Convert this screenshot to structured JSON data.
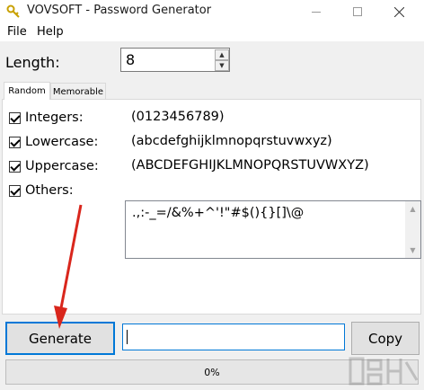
{
  "window": {
    "title": "VOVSOFT - Password Generator",
    "app_icon": "key-icon",
    "controls": [
      "minimize-icon",
      "maximize-icon",
      "close-icon"
    ]
  },
  "menu": [
    "File",
    "Help"
  ],
  "length": {
    "label": "Length:",
    "value": "8"
  },
  "tabs": [
    "Random",
    "Memorable"
  ],
  "active_tab": "Random",
  "options": [
    {
      "label": "Integers:",
      "chars": "(0123456789)",
      "checked": true
    },
    {
      "label": "Lowercase:",
      "chars": "(abcdefghijklmnopqrstuvwxyz)",
      "checked": true
    },
    {
      "label": "Uppercase:",
      "chars": "(ABCDEFGHIJKLMNOPQRSTUVWXYZ)",
      "checked": true
    },
    {
      "label": "Others:",
      "chars": ".,:-_=/&%+^'!\"#$(){}[]\\@",
      "checked": true
    }
  ],
  "buttons": {
    "generate": "Generate",
    "copy": "Copy"
  },
  "password_field": {
    "value": ""
  },
  "progress": {
    "text": "0%",
    "value": 0
  },
  "colors": {
    "focus_border": "#0078d7",
    "annotation_arrow": "#d9261c"
  }
}
